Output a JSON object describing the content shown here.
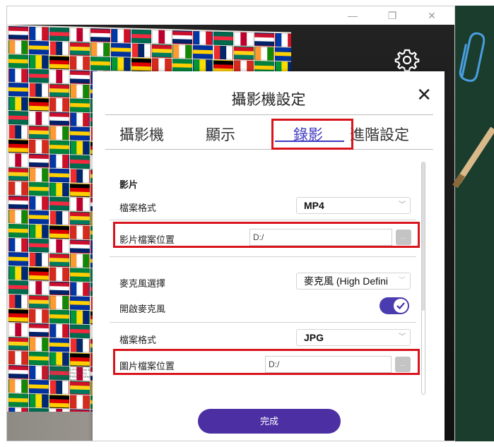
{
  "window": {
    "minimize_glyph": "—",
    "restore_glyph": "❐",
    "close_glyph": "✕"
  },
  "poster": {
    "fineprint": "© 2001 Altar Information Inc. All the part of this document may be reproduced ... the discrepancy between the information ... Other trademarks used herein ..."
  },
  "icons": {
    "settings": "gear-icon",
    "paperclip": "paperclip-icon",
    "pencil": "pencil-icon"
  },
  "dialog": {
    "title": "攝影機設定",
    "close_glyph": "✕",
    "tabs": [
      {
        "label": "攝影機",
        "active": false
      },
      {
        "label": "顯示",
        "active": false
      },
      {
        "label": "錄影",
        "active": true
      },
      {
        "label": "進階設定",
        "active": false
      }
    ],
    "video_section": {
      "heading": "影片",
      "format_label": "檔案格式",
      "format_value": "MP4",
      "location_label": "影片檔案位置",
      "location_value": "D:/",
      "browse_label": "..."
    },
    "audio": {
      "mic_select_label": "麥克風選擇",
      "mic_select_value": "麥克風 (High Defini",
      "enable_mic_label": "開啟麥克風",
      "enable_mic_on": true
    },
    "image_section": {
      "format_label": "檔案格式",
      "format_value": "JPG",
      "location_label": "圖片檔案位置",
      "location_value": "D:/",
      "browse_label": "..."
    },
    "done_label": "完成"
  },
  "colors": {
    "accent": "#4b2fa3",
    "active_tab": "#3f3abf",
    "highlight": "#d8141c",
    "board": "#1b3d2d"
  }
}
